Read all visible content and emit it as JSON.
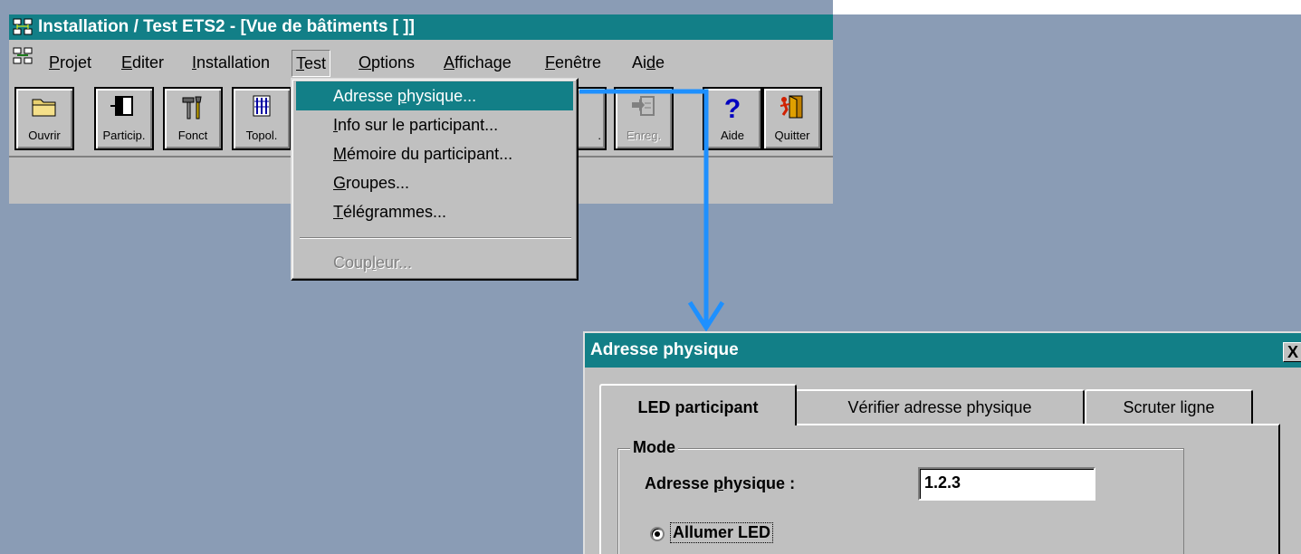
{
  "window": {
    "title": "Installation / Test  ETS2 - [Vue de bâtiments [ ]]"
  },
  "menubar": {
    "items": [
      {
        "label": "Projet",
        "accel": "P",
        "rest": "rojet"
      },
      {
        "label": "Editer",
        "accel": "E",
        "rest": "diter"
      },
      {
        "label": "Installation",
        "accel": "I",
        "rest": "nstallation"
      },
      {
        "label": "Test",
        "accel": "T",
        "rest": "est"
      },
      {
        "label": "Options",
        "accel": "O",
        "rest": "ptions"
      },
      {
        "label": "Affichage",
        "accel": "A",
        "rest": "ffichage"
      },
      {
        "label": "Fenêtre",
        "accel": "F",
        "rest": "enêtre"
      },
      {
        "label": "Aide",
        "pre": "Ai",
        "accel": "d",
        "rest": "e"
      }
    ]
  },
  "toolbar": {
    "buttons": [
      {
        "label": "Ouvrir",
        "icon": "folder-icon"
      },
      {
        "label": "Particip.",
        "icon": "participant-icon"
      },
      {
        "label": "Fonct",
        "icon": "function-tools-icon"
      },
      {
        "label": "Topol.",
        "icon": "topology-icon"
      },
      {
        "label": ".",
        "icon": "hidden-icon"
      },
      {
        "label": "Enreg.",
        "icon": "record-icon"
      },
      {
        "label": "Aide",
        "icon": "help-icon"
      },
      {
        "label": "Quitter",
        "icon": "exit-door-icon"
      }
    ]
  },
  "test_menu": {
    "items": [
      {
        "pre": "Adresse ",
        "accel": "p",
        "rest": "hysique...",
        "state": "selected"
      },
      {
        "pre": "",
        "accel": "I",
        "rest": "nfo sur le participant...",
        "state": "normal"
      },
      {
        "pre": "",
        "accel": "M",
        "rest": "émoire du participant...",
        "state": "normal"
      },
      {
        "pre": "",
        "accel": "G",
        "rest": "roupes...",
        "state": "normal"
      },
      {
        "pre": "",
        "accel": "T",
        "rest": "élégrammes...",
        "state": "normal"
      },
      {
        "pre": "Coup",
        "accel": "l",
        "rest": "eur...",
        "state": "disabled"
      }
    ]
  },
  "dialog": {
    "title": "Adresse physique",
    "close_label": "X",
    "tabs": [
      {
        "label": "LED participant",
        "active": true
      },
      {
        "label": "Vérifier adresse physique",
        "active": false
      },
      {
        "label": "Scruter ligne",
        "active": false
      }
    ],
    "group_title": "Mode",
    "field_label_pre": "Adresse ",
    "field_label_accel": "p",
    "field_label_rest": "hysique :",
    "field_value": "1.2.3",
    "radio_label": "Allumer LED",
    "radio_selected": true
  },
  "colors": {
    "titlebar": "#127f87",
    "desktop": "#8a9cb5",
    "face": "#c0c0c0",
    "annotation_arrow": "#1e90ff"
  }
}
